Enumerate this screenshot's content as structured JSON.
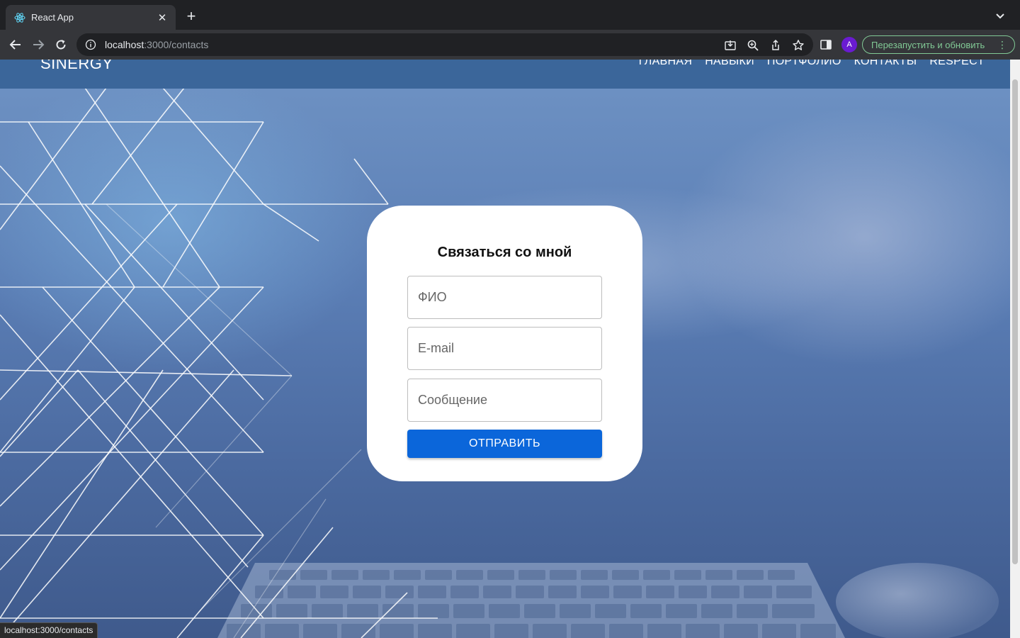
{
  "browser": {
    "tab_title": "React App",
    "url_host": "localhost",
    "url_path": ":3000/contacts",
    "profile_initial": "A",
    "update_button_label": "Перезапустить и обновить",
    "status_url": "localhost:3000/contacts",
    "colors": {
      "frame": "#202124",
      "toolbar": "#35363a",
      "update_accent": "#81c995",
      "avatar": "#6a1bd1"
    }
  },
  "header": {
    "brand": "SINERGY",
    "nav": [
      "ГЛАВНАЯ",
      "НАВЫКИ",
      "ПОРТФОЛИО",
      "КОНТАКТЫ",
      "RESPECT"
    ],
    "color": "#3b669a"
  },
  "contact_form": {
    "title": "Связаться со мной",
    "fields": [
      {
        "placeholder": "ФИО",
        "value": ""
      },
      {
        "placeholder": "E-mail",
        "value": ""
      },
      {
        "placeholder": "Сообщение",
        "value": ""
      }
    ],
    "submit_label": "ОТПРАВИТЬ",
    "submit_color": "#0b66da"
  }
}
